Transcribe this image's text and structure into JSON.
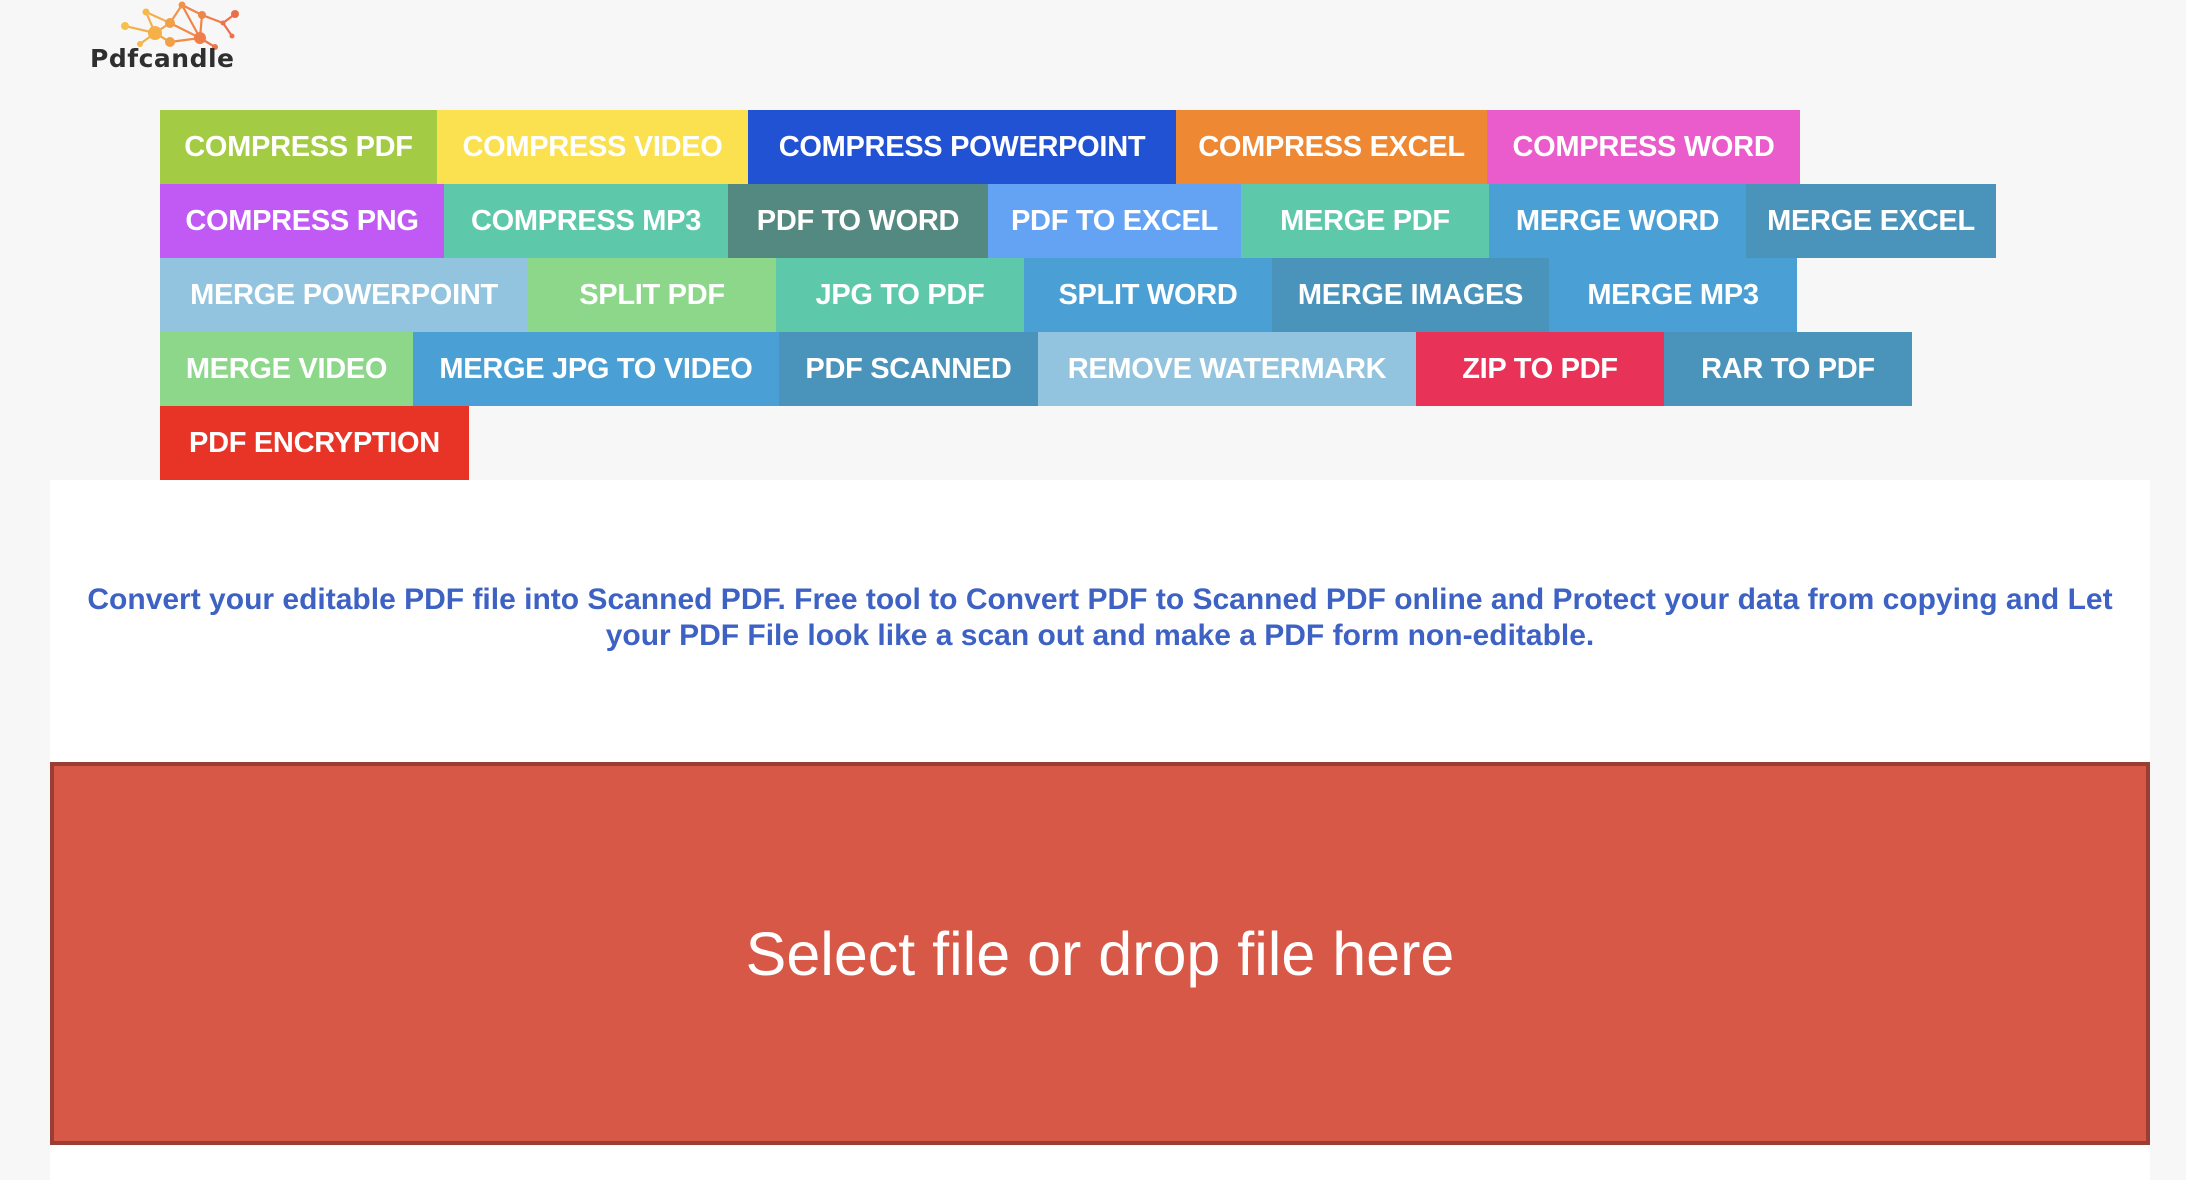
{
  "brand": {
    "name": "Pdfcandle",
    "logo_icon": "molecule-network-logo"
  },
  "tools": {
    "rows": [
      [
        {
          "label": "COMPRESS PDF",
          "color": "#a3cb43"
        },
        {
          "label": "COMPRESS VIDEO",
          "color": "#fbe14f"
        },
        {
          "label": "COMPRESS POWERPOINT",
          "color": "#2152d4"
        },
        {
          "label": "COMPRESS EXCEL",
          "color": "#ee8833"
        },
        {
          "label": "COMPRESS WORD",
          "color": "#ea5bcb"
        }
      ],
      [
        {
          "label": "COMPRESS PNG",
          "color": "#c159f4"
        },
        {
          "label": "COMPRESS MP3",
          "color": "#5ec9aa"
        },
        {
          "label": "PDF TO WORD",
          "color": "#548981"
        },
        {
          "label": "PDF TO EXCEL",
          "color": "#64a3f3"
        },
        {
          "label": "MERGE PDF",
          "color": "#5ec9aa"
        },
        {
          "label": "MERGE WORD",
          "color": "#4a9fd5"
        },
        {
          "label": "MERGE EXCEL",
          "color": "#4a93bb"
        }
      ],
      [
        {
          "label": "MERGE POWERPOINT",
          "color": "#93c4df"
        },
        {
          "label": "SPLIT PDF",
          "color": "#8dd78b"
        },
        {
          "label": "JPG TO PDF",
          "color": "#5ec9aa"
        },
        {
          "label": "SPLIT WORD",
          "color": "#4a9fd5"
        },
        {
          "label": "MERGE IMAGES",
          "color": "#4a93bb"
        },
        {
          "label": "MERGE MP3",
          "color": "#4a9fd5"
        }
      ],
      [
        {
          "label": "MERGE VIDEO",
          "color": "#8dd78b"
        },
        {
          "label": "MERGE JPG TO VIDEO",
          "color": "#4a9fd5"
        },
        {
          "label": "PDF SCANNED",
          "color": "#4a93bb"
        },
        {
          "label": "REMOVE WATERMARK",
          "color": "#93c4df"
        },
        {
          "label": "ZIP TO PDF",
          "color": "#e83257"
        },
        {
          "label": "RAR TO PDF",
          "color": "#4a93bb"
        }
      ],
      [
        {
          "label": "PDF ENCRYPTION",
          "color": "#e83427"
        }
      ]
    ]
  },
  "main": {
    "description": "Convert your editable PDF file into Scanned PDF. Free tool to Convert PDF to Scanned PDF online and Protect your data from copying and Let your PDF File look like a scan out and make a PDF form non-editable.",
    "description_color": "#3d62c4",
    "dropzone_label": "Select file or drop file here",
    "dropzone_color": "#d75846"
  }
}
